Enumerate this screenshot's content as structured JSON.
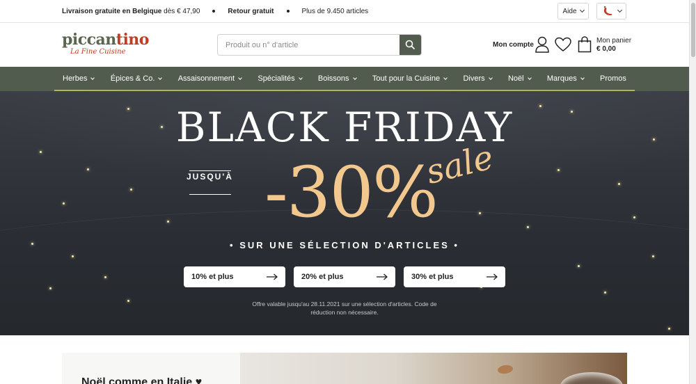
{
  "topbar": {
    "shipping_bold": "Livraison gratuite en Belgique",
    "shipping_rest": "dès € 47,90",
    "returns": "Retour gratuit",
    "articles": "Plus de 9.450 articles",
    "help_label": "Aide"
  },
  "header": {
    "logo_word_a": "piccan",
    "logo_word_b": "tino",
    "logo_tagline": "La Fine Cuisine",
    "search_placeholder": "Produit ou n° d'article",
    "account_label": "Mon compte",
    "cart_label": "Mon panier",
    "cart_amount": "€ 0,00"
  },
  "nav": {
    "items": [
      {
        "label": "Herbes",
        "dropdown": true
      },
      {
        "label": "Épices & Co.",
        "dropdown": true
      },
      {
        "label": "Assaisonnement",
        "dropdown": true
      },
      {
        "label": "Spécialités",
        "dropdown": true
      },
      {
        "label": "Boissons",
        "dropdown": true
      },
      {
        "label": "Tout pour la Cuisine",
        "dropdown": true
      },
      {
        "label": "Divers",
        "dropdown": true
      },
      {
        "label": "Noël",
        "dropdown": true
      },
      {
        "label": "Marques",
        "dropdown": true
      },
      {
        "label": "Promos",
        "dropdown": false
      }
    ]
  },
  "hero": {
    "title": "BLACK FRIDAY",
    "upto": "JUSQU'À",
    "percent": "-30%",
    "sale": "sale",
    "selection": "• SUR UNE SÉLECTION D'ARTICLES •",
    "offers": [
      "10% et plus",
      "20% et plus",
      "30% et plus"
    ],
    "note_line1": "Offre valable jusqu'au 28.11.2021 sur une sélection d'articles. Code de",
    "note_line2": "réduction non nécessaire.",
    "colors": {
      "background": "#2a2d33",
      "accent": "#f2c88e"
    }
  },
  "promo": {
    "title": "Noël comme en Italie ♥"
  },
  "colors": {
    "nav_bg": "#525c4e",
    "nav_underline": "#b6b25a",
    "logo_green": "#5a6650",
    "logo_red": "#c23b22"
  }
}
